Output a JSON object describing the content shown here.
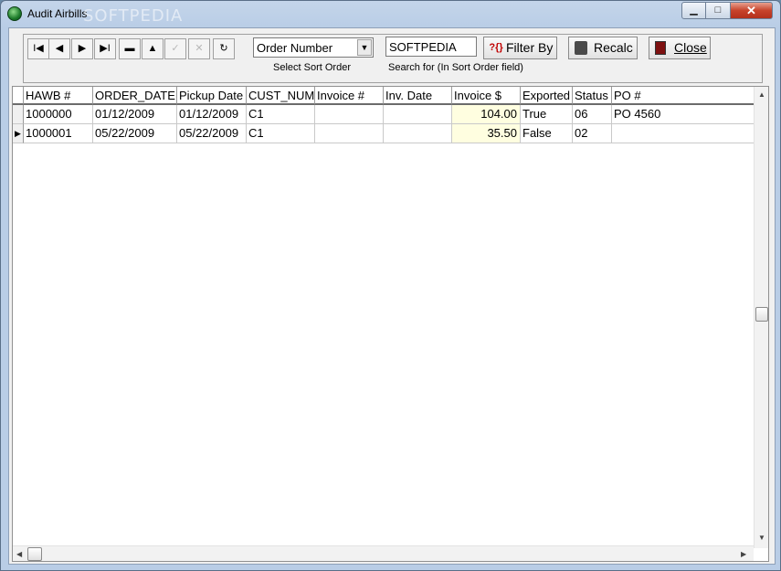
{
  "window": {
    "title": "Audit Airbills",
    "watermark": "SOFTPEDIA",
    "minimize_glyph": "▁",
    "maximize_glyph": "□",
    "close_glyph": "✕"
  },
  "toolbar": {
    "nav": {
      "first": "I◀",
      "prior": "◀",
      "next": "▶",
      "last": "▶I",
      "delete": "▬",
      "edit": "▲",
      "post": "✓",
      "cancel": "✕",
      "refresh": "↻"
    },
    "sort_order_value": "Order Number",
    "sort_order_caption": "Select Sort Order",
    "search_value": "SOFTPEDIA",
    "search_caption": "Search for (In Sort Order field)",
    "filter_label": "Filter By",
    "filter_icon_text": "?{}",
    "recalc_label": "Recalc",
    "close_label": "Close",
    "icons": {
      "filter": "filter-icon",
      "recalc": "calculator-icon",
      "close": "exit-door-icon"
    }
  },
  "grid": {
    "columns": [
      "HAWB #",
      "ORDER_DATE",
      "Pickup Date",
      "CUST_NUM",
      "Invoice #",
      "Inv. Date",
      "Invoice $",
      "Exported",
      "Status",
      "PO #"
    ],
    "rows": [
      [
        "1000000",
        "01/12/2009",
        "01/12/2009",
        "C1",
        "",
        "",
        "104.00",
        "True",
        "06",
        "PO 4560"
      ],
      [
        "1000001",
        "05/22/2009",
        "05/22/2009",
        "C1",
        "",
        "",
        "35.50",
        "False",
        "02",
        ""
      ]
    ],
    "current_row_marker": "▶",
    "accent_color": "#fffee0"
  }
}
